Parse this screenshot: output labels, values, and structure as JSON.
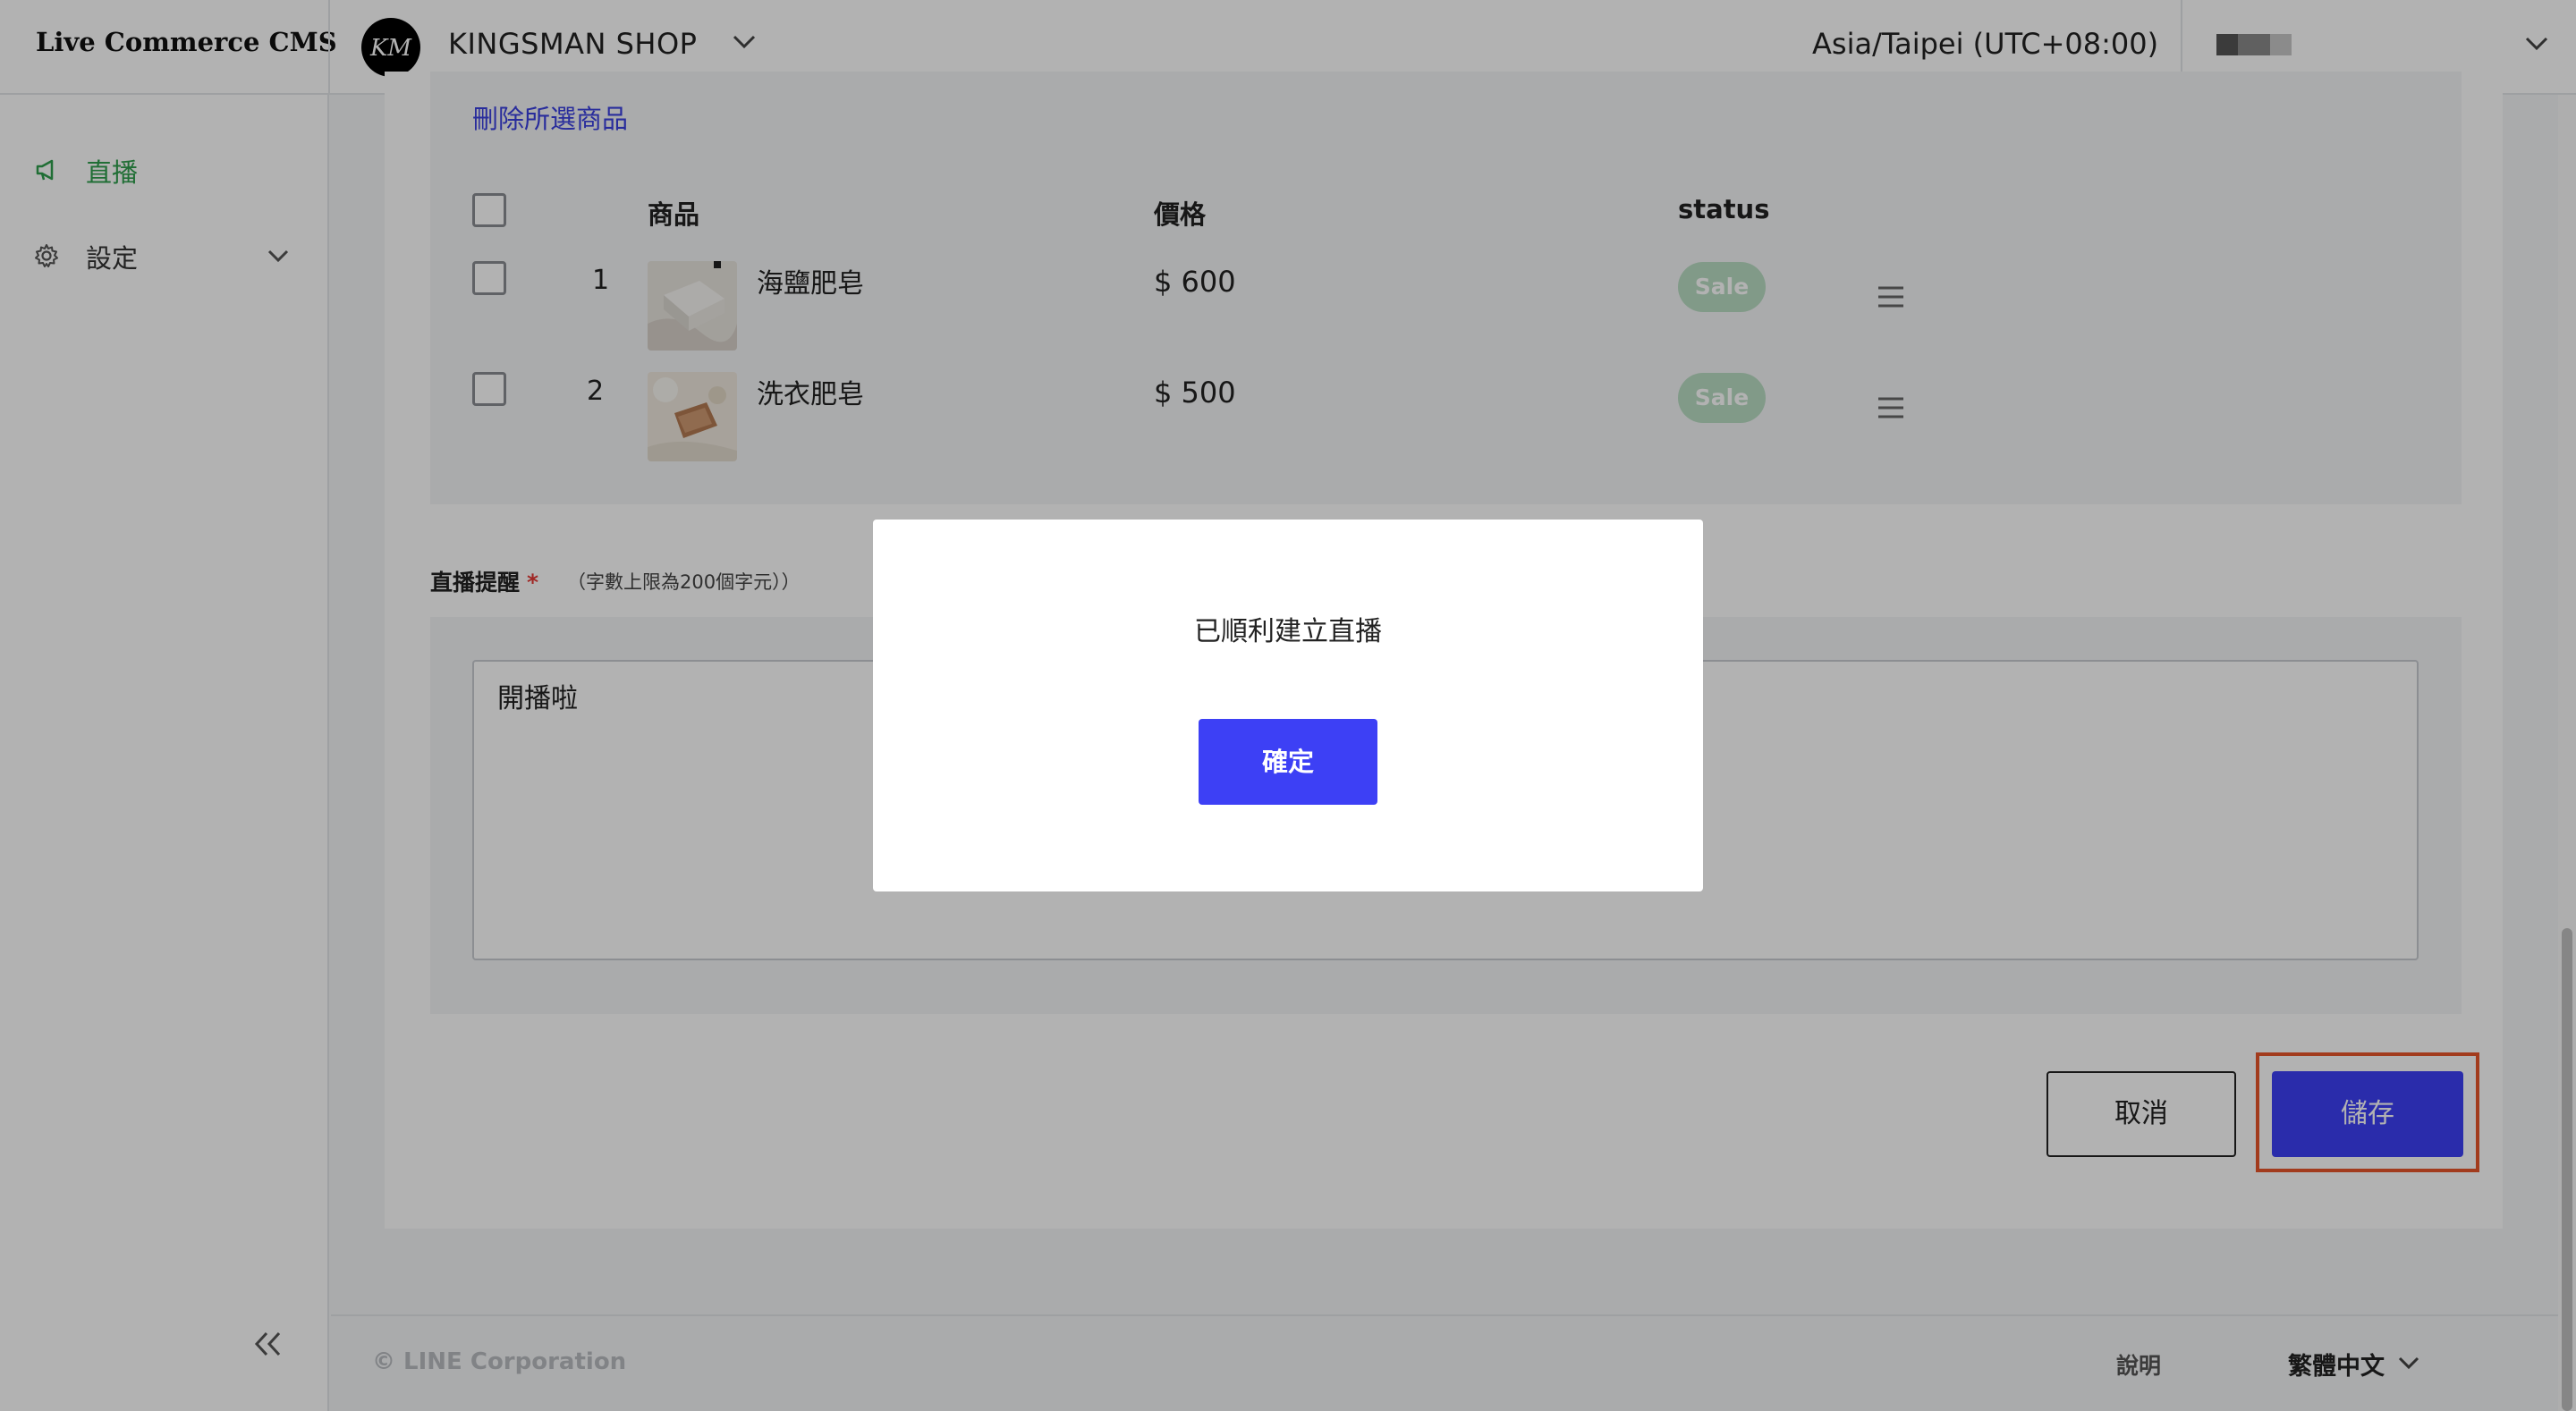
{
  "header": {
    "brand": "Live Commerce CMS",
    "shop_name": "KINGSMAN SHOP",
    "shop_logo_initials": "KM",
    "timezone": "Asia/Taipei (UTC+08:00)"
  },
  "sidebar": {
    "items": [
      {
        "label": "直播",
        "icon": "megaphone-icon"
      },
      {
        "label": "設定",
        "icon": "gear-icon"
      }
    ]
  },
  "products": {
    "delete_selected": "刪除所選商品",
    "columns": {
      "product": "商品",
      "price": "價格",
      "status": "status"
    },
    "rows": [
      {
        "index": "1",
        "name": "海鹽肥皂",
        "price": "$ 600",
        "status": "Sale"
      },
      {
        "index": "2",
        "name": "洗衣肥皂",
        "price": "$ 500",
        "status": "Sale"
      }
    ]
  },
  "reminder": {
    "label": "直播提醒",
    "required_mark": "*",
    "hint": "（字數上限為200個字元））",
    "value": "開播啦"
  },
  "actions": {
    "cancel": "取消",
    "save": "儲存"
  },
  "footer": {
    "copyright": "© LINE Corporation",
    "help": "說明",
    "language": "繁體中文"
  },
  "modal": {
    "message": "已順利建立直播",
    "confirm": "確定"
  },
  "colors": {
    "accent": "#3d40f5",
    "nav_active": "#2f9e4c",
    "badge": "#b9ddc3",
    "highlight": "#e8552a"
  }
}
